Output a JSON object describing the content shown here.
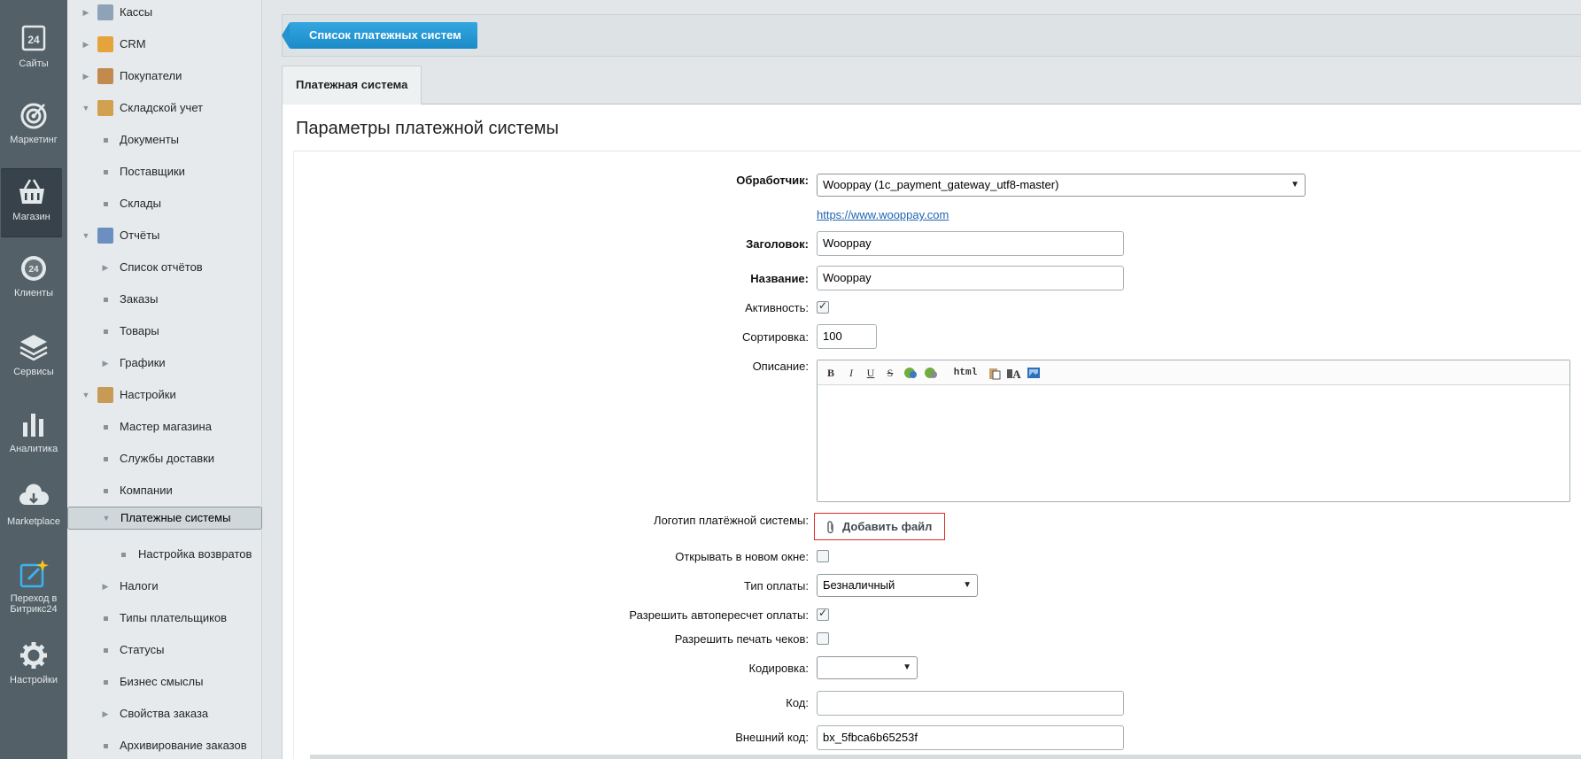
{
  "rail": [
    {
      "label": "Сайты",
      "icon": "sites-icon"
    },
    {
      "label": "Маркетинг",
      "icon": "target-icon"
    },
    {
      "label": "Магазин",
      "icon": "basket-icon",
      "active": true
    },
    {
      "label": "Клиенты",
      "icon": "clients-icon"
    },
    {
      "label": "Сервисы",
      "icon": "layers-icon"
    },
    {
      "label": "Аналитика",
      "icon": "analytics-icon"
    },
    {
      "label": "Marketplace",
      "icon": "cloud-download-icon"
    },
    {
      "label1": "Переход в",
      "label2": "Битрикс24",
      "icon": "bitrix24-icon"
    },
    {
      "label": "Настройки",
      "icon": "gear-icon"
    }
  ],
  "menu": [
    {
      "label": "Кассы",
      "type": "collapsed",
      "icon": "cash-register-icon"
    },
    {
      "label": "CRM",
      "type": "collapsed",
      "icon": "crm-icon"
    },
    {
      "label": "Покупатели",
      "type": "collapsed",
      "icon": "buyers-icon"
    },
    {
      "label": "Складской учет",
      "type": "expanded",
      "icon": "warehouse-icon"
    },
    {
      "label": "Документы",
      "type": "leaf"
    },
    {
      "label": "Поставщики",
      "type": "leaf"
    },
    {
      "label": "Склады",
      "type": "leaf"
    },
    {
      "label": "Отчёты",
      "type": "expanded",
      "icon": "reports-icon"
    },
    {
      "label": "Список отчётов",
      "type": "collapsed-sub"
    },
    {
      "label": "Заказы",
      "type": "leaf"
    },
    {
      "label": "Товары",
      "type": "leaf"
    },
    {
      "label": "Графики",
      "type": "collapsed-sub"
    },
    {
      "label": "Настройки",
      "type": "expanded",
      "icon": "settings-folder-icon"
    },
    {
      "label": "Мастер магазина",
      "type": "leaf"
    },
    {
      "label": "Службы доставки",
      "type": "leaf"
    },
    {
      "label": "Компании",
      "type": "leaf"
    },
    {
      "label": "Платежные системы",
      "type": "expanded-sub",
      "selected": true
    },
    {
      "label": "Настройка возвратов",
      "type": "leaf2"
    },
    {
      "label": "Налоги",
      "type": "collapsed-sub"
    },
    {
      "label": "Типы плательщиков",
      "type": "leaf"
    },
    {
      "label": "Статусы",
      "type": "leaf"
    },
    {
      "label": "Бизнес смыслы",
      "type": "leaf"
    },
    {
      "label": "Свойства заказа",
      "type": "collapsed-sub"
    },
    {
      "label": "Архивирование заказов",
      "type": "leaf"
    }
  ],
  "topbar": {
    "list_button": "Список платежных систем"
  },
  "tab": {
    "label": "Платежная система"
  },
  "panel": {
    "title": "Параметры платежной системы"
  },
  "form": {
    "handler_label": "Обработчик:",
    "handler_value": "Wooppay (1c_payment_gateway_utf8-master)",
    "handler_link": "https://www.wooppay.com",
    "heading_label": "Заголовок:",
    "heading_value": "Wooppay",
    "name_label": "Название:",
    "name_value": "Wooppay",
    "active_label": "Активность:",
    "active_checked": true,
    "sort_label": "Сортировка:",
    "sort_value": "100",
    "description_label": "Описание:",
    "editor_html_label": "html",
    "logo_label": "Логотип платёжной системы:",
    "add_file_label": "Добавить файл",
    "new_window_label": "Открывать в новом окне:",
    "new_window_checked": false,
    "pay_type_label": "Тип оплаты:",
    "pay_type_value": "Безналичный",
    "auto_recalc_label": "Разрешить автопересчет оплаты:",
    "auto_recalc_checked": true,
    "print_checks_label": "Разрешить печать чеков:",
    "print_checks_checked": false,
    "encoding_label": "Кодировка:",
    "encoding_value": "",
    "code_label": "Код:",
    "code_value": "",
    "ext_code_label": "Внешний код:",
    "ext_code_value": "bx_5fbca6b65253f"
  },
  "colors": {
    "rail_bg": "#536068",
    "menu_bg": "#e6eaec",
    "accent_button": "#2899d6",
    "link": "#2066b3",
    "add_file_border": "#e02a2a"
  }
}
